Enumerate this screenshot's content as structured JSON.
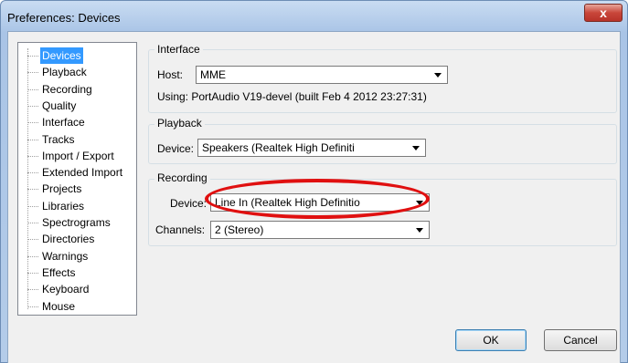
{
  "window": {
    "title": "Preferences: Devices",
    "close_label": "x"
  },
  "tree": {
    "items": [
      {
        "label": "Devices",
        "selected": true
      },
      {
        "label": "Playback"
      },
      {
        "label": "Recording"
      },
      {
        "label": "Quality"
      },
      {
        "label": "Interface"
      },
      {
        "label": "Tracks"
      },
      {
        "label": "Import / Export"
      },
      {
        "label": "Extended Import"
      },
      {
        "label": "Projects"
      },
      {
        "label": "Libraries"
      },
      {
        "label": "Spectrograms"
      },
      {
        "label": "Directories"
      },
      {
        "label": "Warnings"
      },
      {
        "label": "Effects"
      },
      {
        "label": "Keyboard"
      },
      {
        "label": "Mouse"
      }
    ]
  },
  "interface": {
    "title": "Interface",
    "host_label": "Host:",
    "host_value": "MME",
    "using_text": "Using: PortAudio V19-devel (built Feb  4 2012 23:27:31)"
  },
  "playback": {
    "title": "Playback",
    "device_label": "Device:",
    "device_value": "Speakers (Realtek High Definiti"
  },
  "recording": {
    "title": "Recording",
    "device_label": "Device:",
    "device_value": "Line In (Realtek High Definitio",
    "channels_label": "Channels:",
    "channels_value": "2 (Stereo)"
  },
  "buttons": {
    "ok": "OK",
    "cancel": "Cancel"
  },
  "colors": {
    "highlight_annotation": "#e01010",
    "selection": "#3399ff"
  }
}
